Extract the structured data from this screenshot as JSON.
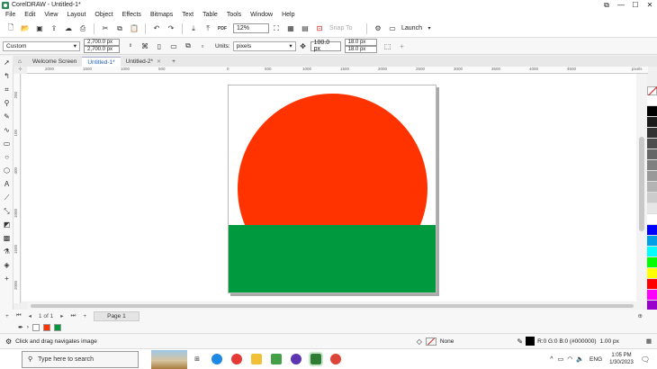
{
  "window": {
    "title": "CorelDRAW - Untitled-1*"
  },
  "menu": [
    "File",
    "Edit",
    "View",
    "Layout",
    "Object",
    "Effects",
    "Bitmaps",
    "Text",
    "Table",
    "Tools",
    "Window",
    "Help"
  ],
  "toolbar": {
    "zoom": "12%",
    "snap_to": "Snap To",
    "launch": "Launch",
    "pdf": "PDF"
  },
  "propbar": {
    "preset": "Custom",
    "width": "2,700.0 px",
    "height": "2,700.0 px",
    "units_label": "Units:",
    "units": "pixels",
    "nudge": "100.0 px",
    "dup_x": "18.0 px",
    "dup_y": "18.0 px"
  },
  "tabs": [
    {
      "label": "Welcome Screen"
    },
    {
      "label": "Untitled-1*"
    },
    {
      "label": "Untitled-2*"
    }
  ],
  "ruler": {
    "h_labels": [
      "2000",
      "1500",
      "1000",
      "500",
      "0",
      "500",
      "1000",
      "1500",
      "2000",
      "2500",
      "3000",
      "3500",
      "4000",
      "4500"
    ],
    "h_unit": "pixels",
    "v_labels": [
      "200",
      "100",
      "400",
      "1000",
      "1500",
      "2000"
    ],
    "v_unit": "pixels"
  },
  "drawing": {
    "sun_color": "#ff3300",
    "field_color": "#00993d",
    "page_color": "#ffffff"
  },
  "palette": [
    "#ffffff",
    "#000000",
    "#1a1a1a",
    "#333333",
    "#4d4d4d",
    "#666666",
    "#808080",
    "#999999",
    "#b3b3b3",
    "#cccccc",
    "#e6e6e6",
    "#ffffff",
    "#0000ff",
    "#00a0e9",
    "#00ffff",
    "#00ff00",
    "#ffff00",
    "#ff0000",
    "#ff00ff",
    "#9900cc",
    "#ff6699",
    "#cccccc",
    "#ffcccc",
    "#aaaaee"
  ],
  "pagenav": {
    "counter": "1 of 1",
    "page_label": "Page 1"
  },
  "status": {
    "hint": "Click and drag navigates image",
    "fill": "None",
    "outline": "R:0 G:0 B:0 (#000000)",
    "outline_width": "1.00 px"
  },
  "taskbar": {
    "search_placeholder": "Type here to search",
    "lang": "ENG",
    "time": "1:05 PM",
    "date": "1/30/2023"
  }
}
